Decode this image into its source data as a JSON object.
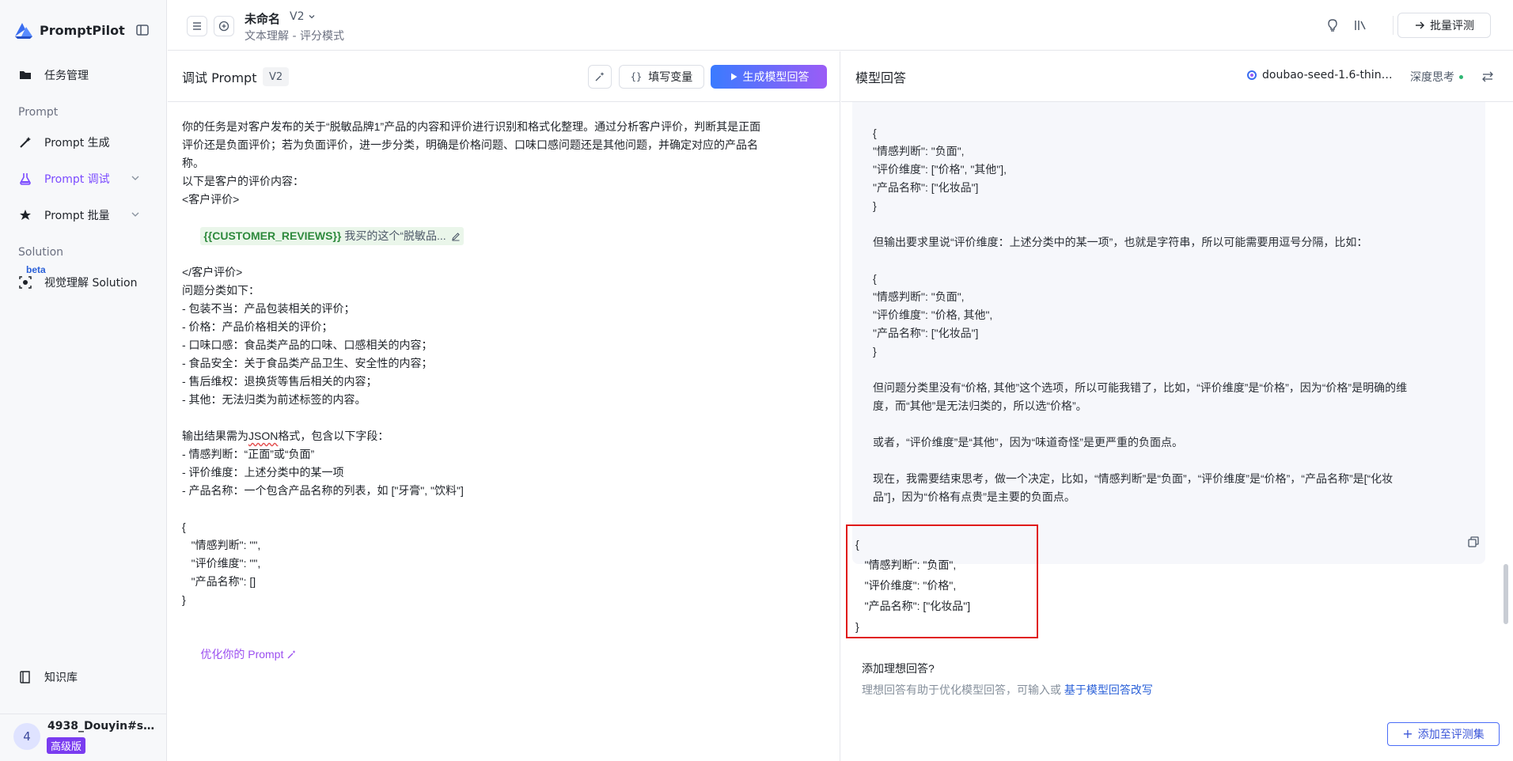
{
  "sidebar": {
    "brand": "PromptPilot",
    "items": [
      {
        "label": "任务管理",
        "icon": "folder-icon"
      },
      {
        "label": "Prompt 生成",
        "icon": "wand-icon"
      },
      {
        "label": "Prompt 调试",
        "icon": "flask-icon",
        "active": true
      },
      {
        "label": "Prompt 批量",
        "icon": "batch-icon"
      },
      {
        "label": "视觉理解 Solution",
        "icon": "eye-scan-icon"
      },
      {
        "label": "知识库",
        "icon": "book-icon"
      }
    ],
    "section_prompt": "Prompt",
    "section_solution": "Solution",
    "beta": "beta",
    "user": {
      "avatar": "4",
      "name": "4938_Douyin#sd...",
      "plan": "高级版"
    }
  },
  "topbar": {
    "title": "未命名",
    "version": "V2",
    "subtitle": "文本理解 - 评分模式",
    "batch_eval": "批量评测"
  },
  "left": {
    "title": "调试 Prompt",
    "version": "V2",
    "fill_vars": "填写变量",
    "generate": "生成模型回答",
    "prompt_lines": [
      "你的任务是对客户发布的关于“脱敏品牌1”产品的内容和评价进行识别和格式化整理。通过分析客户评价，判断其是正面",
      "评价还是负面评价；若为负面评价，进一步分类，明确是价格问题、口味口感问题还是其他问题，并确定对应的产品名",
      "称。",
      "以下是客户的评价内容：",
      "<客户评价>"
    ],
    "var_name": "{{CUSTOMER_REVIEWS}}",
    "var_value": "我买的这个“脱敏品...",
    "prompt_lines_2": [
      "</客户评价>",
      "问题分类如下：",
      "- 包装不当：产品包装相关的评价；",
      "- 价格：产品价格相关的评价；",
      "- 口味口感：食品类产品的口味、口感相关的内容；",
      "- 食品安全：关于食品类产品卫生、安全性的内容；",
      "- 售后维权：退换货等售后相关的内容；",
      "- 其他：无法归类为前述标签的内容。",
      ""
    ],
    "output_prefix": "输出结果需为",
    "output_json_word": "JSON",
    "output_suffix": "格式，包含以下字段：",
    "prompt_lines_3": [
      "- 情感判断：“正面”或“负面”",
      "- 评价维度：上述分类中的某一项",
      "- 产品名称：一个包含产品名称的列表，如 [\"牙膏\", \"饮料\"]",
      "",
      "{",
      "   \"情感判断\": \"\",",
      "   \"评价维度\": \"\",",
      "   \"产品名称\": []",
      "}",
      ""
    ],
    "optimize": "优化你的 Prompt"
  },
  "right": {
    "title": "模型回答",
    "model": "doubao-seed-1.6-thinki...",
    "think_mode": "深度思考",
    "think_lines": [
      "{",
      "\"情感判断\": \"负面\",",
      "\"评价维度\": [\"价格\", \"其他\"],",
      "\"产品名称\": [\"化妆品\"]",
      "}",
      "",
      "但输出要求里说“评价维度：上述分类中的某一项”，也就是字符串，所以可能需要用逗号分隔，比如：",
      "",
      "{",
      "\"情感判断\": \"负面\",",
      "\"评价维度\": \"价格, 其他\",",
      "\"产品名称\": [\"化妆品\"]",
      "}",
      "",
      "但问题分类里没有“价格, 其他”这个选项，所以可能我错了，比如，“评价维度”是“价格”，因为“价格”是明确的维",
      "度，而“其他”是无法归类的，所以选“价格”。",
      "",
      "或者，“评价维度”是“其他”，因为“味道奇怪”是更严重的负面点。",
      "",
      "现在，我需要结束思考，做一个决定，比如，“情感判断”是“负面”，“评价维度”是“价格”，“产品名称”是[“化妆",
      "品”]，因为“价格有点贵”是主要的负面点。"
    ],
    "answer": "{\n   \"情感判断\": \"负面\",\n   \"评价维度\": \"价格\",\n   \"产品名称\": [\"化妆品\"]\n}",
    "ideal_title": "添加理想回答?",
    "ideal_desc": "理想回答有助于优化模型回答，可输入或 ",
    "ideal_link": "基于模型回答改写",
    "add_eval": "添加至评测集"
  }
}
